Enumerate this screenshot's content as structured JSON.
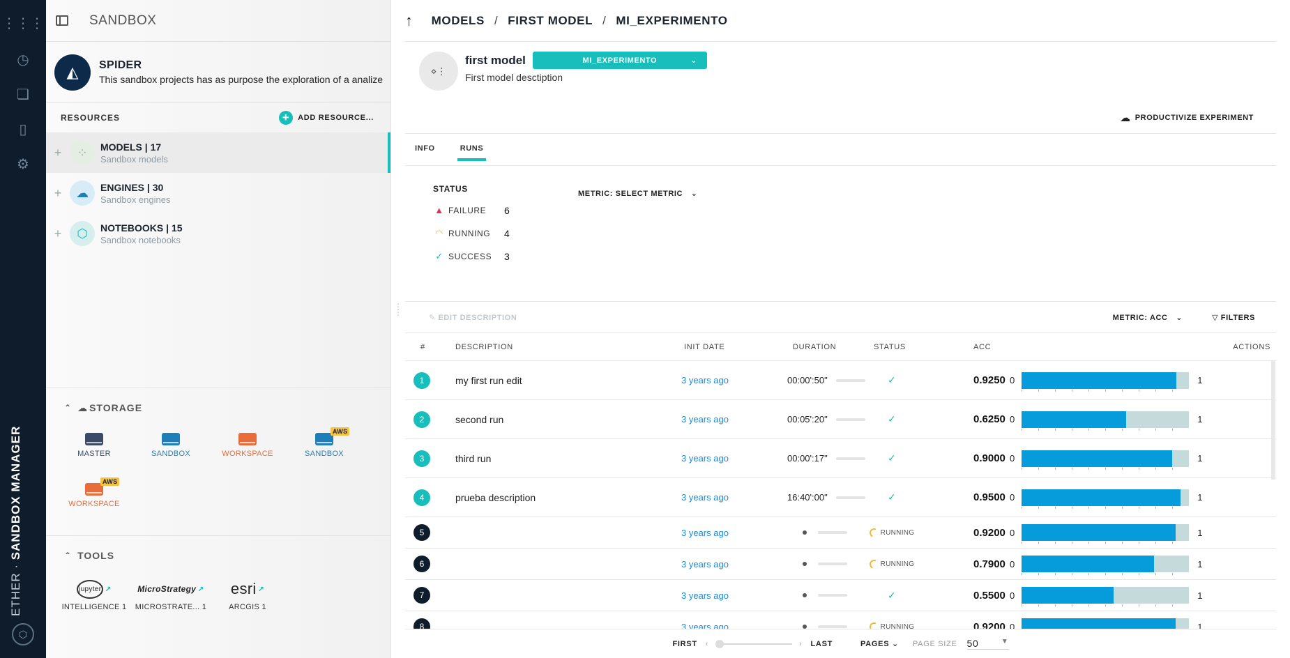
{
  "sidebar": {
    "title": "SANDBOX",
    "project": {
      "name": "SPIDER",
      "description": "This sandbox projects has as purpose the exploration of a analize ..."
    },
    "resources_label": "RESOURCES",
    "add_resource_label": "ADD RESOURCE...",
    "resources": [
      {
        "title": "MODELS | 17",
        "subtitle": "Sandbox models"
      },
      {
        "title": "ENGINES | 30",
        "subtitle": "Sandbox engines"
      },
      {
        "title": "NOTEBOOKS | 15",
        "subtitle": "Sandbox notebooks"
      }
    ],
    "storage_label": "STORAGE",
    "storage": [
      {
        "label": "MASTER",
        "color": "#3b4a66"
      },
      {
        "label": "SANDBOX",
        "color": "#1e7fb8"
      },
      {
        "label": "WORKSPACE",
        "color": "#e86d3a"
      },
      {
        "label": "SANDBOX",
        "color": "#1e7fb8",
        "badge": "AWS"
      },
      {
        "label": "WORKSPACE",
        "color": "#e86d3a",
        "badge": "AWS"
      }
    ],
    "tools_label": "TOOLS",
    "tools": [
      {
        "logo": "jupyter",
        "label": "INTELLIGENCE 1"
      },
      {
        "logo": "MicroStrategy",
        "label": "MICROSTRATE... 1"
      },
      {
        "logo": "esri",
        "label": "ARCGIS 1"
      }
    ]
  },
  "rail": {
    "brand_prefix": "ETHER · ",
    "brand_bold": "SANDBOX MANAGER"
  },
  "breadcrumb": {
    "models": "MODELS",
    "first_model": "FIRST MODEL",
    "experiment": "MI_EXPERIMENTO"
  },
  "model": {
    "name": "first model",
    "experiment": "MI_EXPERIMENTO",
    "description": "First model desctiption"
  },
  "productivize_label": "PRODUCTIVIZE EXPERIMENT",
  "tabs": [
    "INFO",
    "RUNS"
  ],
  "status_panel": {
    "title": "STATUS",
    "rows": [
      {
        "label": "FAILURE",
        "count": "6"
      },
      {
        "label": "RUNNING",
        "count": "4"
      },
      {
        "label": "SUCCESS",
        "count": "3"
      }
    ]
  },
  "metric_select_label": "METRIC: SELECT METRIC",
  "toolbar": {
    "edit_description": "EDIT DESCRIPTION",
    "metric": "METRIC: ACC",
    "filters": "FILTERS"
  },
  "table": {
    "headers": [
      "#",
      "DESCRIPTION",
      "INIT DATE",
      "DURATION",
      "STATUS",
      "ACC",
      "ACTIONS"
    ],
    "rows": [
      {
        "n": "1",
        "desc": "my first run edit",
        "date": "3 years ago",
        "duration": "00:00':50\"",
        "status": "success",
        "acc": "0.9250",
        "fill": 0.925,
        "min": "0",
        "max": "1"
      },
      {
        "n": "2",
        "desc": "second run",
        "date": "3 years ago",
        "duration": "00:05':20\"",
        "status": "success",
        "acc": "0.6250",
        "fill": 0.625,
        "min": "0",
        "max": "1"
      },
      {
        "n": "3",
        "desc": "third run",
        "date": "3 years ago",
        "duration": "00:00':17\"",
        "status": "success",
        "acc": "0.9000",
        "fill": 0.9,
        "min": "0",
        "max": "1"
      },
      {
        "n": "4",
        "desc": "prueba description",
        "date": "3 years ago",
        "duration": "16:40':00\"",
        "status": "success",
        "acc": "0.9500",
        "fill": 0.95,
        "min": "0",
        "max": "1"
      },
      {
        "n": "5",
        "desc": "",
        "date": "3 years ago",
        "duration": "",
        "status": "running",
        "status_text": "RUNNING",
        "acc": "0.9200",
        "fill": 0.92,
        "min": "0",
        "max": "1"
      },
      {
        "n": "6",
        "desc": "",
        "date": "3 years ago",
        "duration": "",
        "status": "running",
        "status_text": "RUNNING",
        "acc": "0.7900",
        "fill": 0.79,
        "min": "0",
        "max": "1"
      },
      {
        "n": "7",
        "desc": "",
        "date": "3 years ago",
        "duration": "",
        "status": "success",
        "acc": "0.5500",
        "fill": 0.55,
        "min": "0",
        "max": "1"
      },
      {
        "n": "8",
        "desc": "",
        "date": "3 years ago",
        "duration": "",
        "status": "running",
        "status_text": "RUNNING",
        "acc": "0.9200",
        "fill": 0.92,
        "min": "0",
        "max": "1"
      }
    ]
  },
  "pager": {
    "first": "FIRST",
    "last": "LAST",
    "pages": "PAGES",
    "page_size_label": "PAGE SIZE",
    "page_size": "50"
  },
  "colors": {
    "accent": "#17bebb",
    "bar": "#069cdc",
    "success_num": "#17bebb",
    "running_num": "#0e1c2b",
    "failure": "#e0334c",
    "running": "#f3b73a"
  }
}
